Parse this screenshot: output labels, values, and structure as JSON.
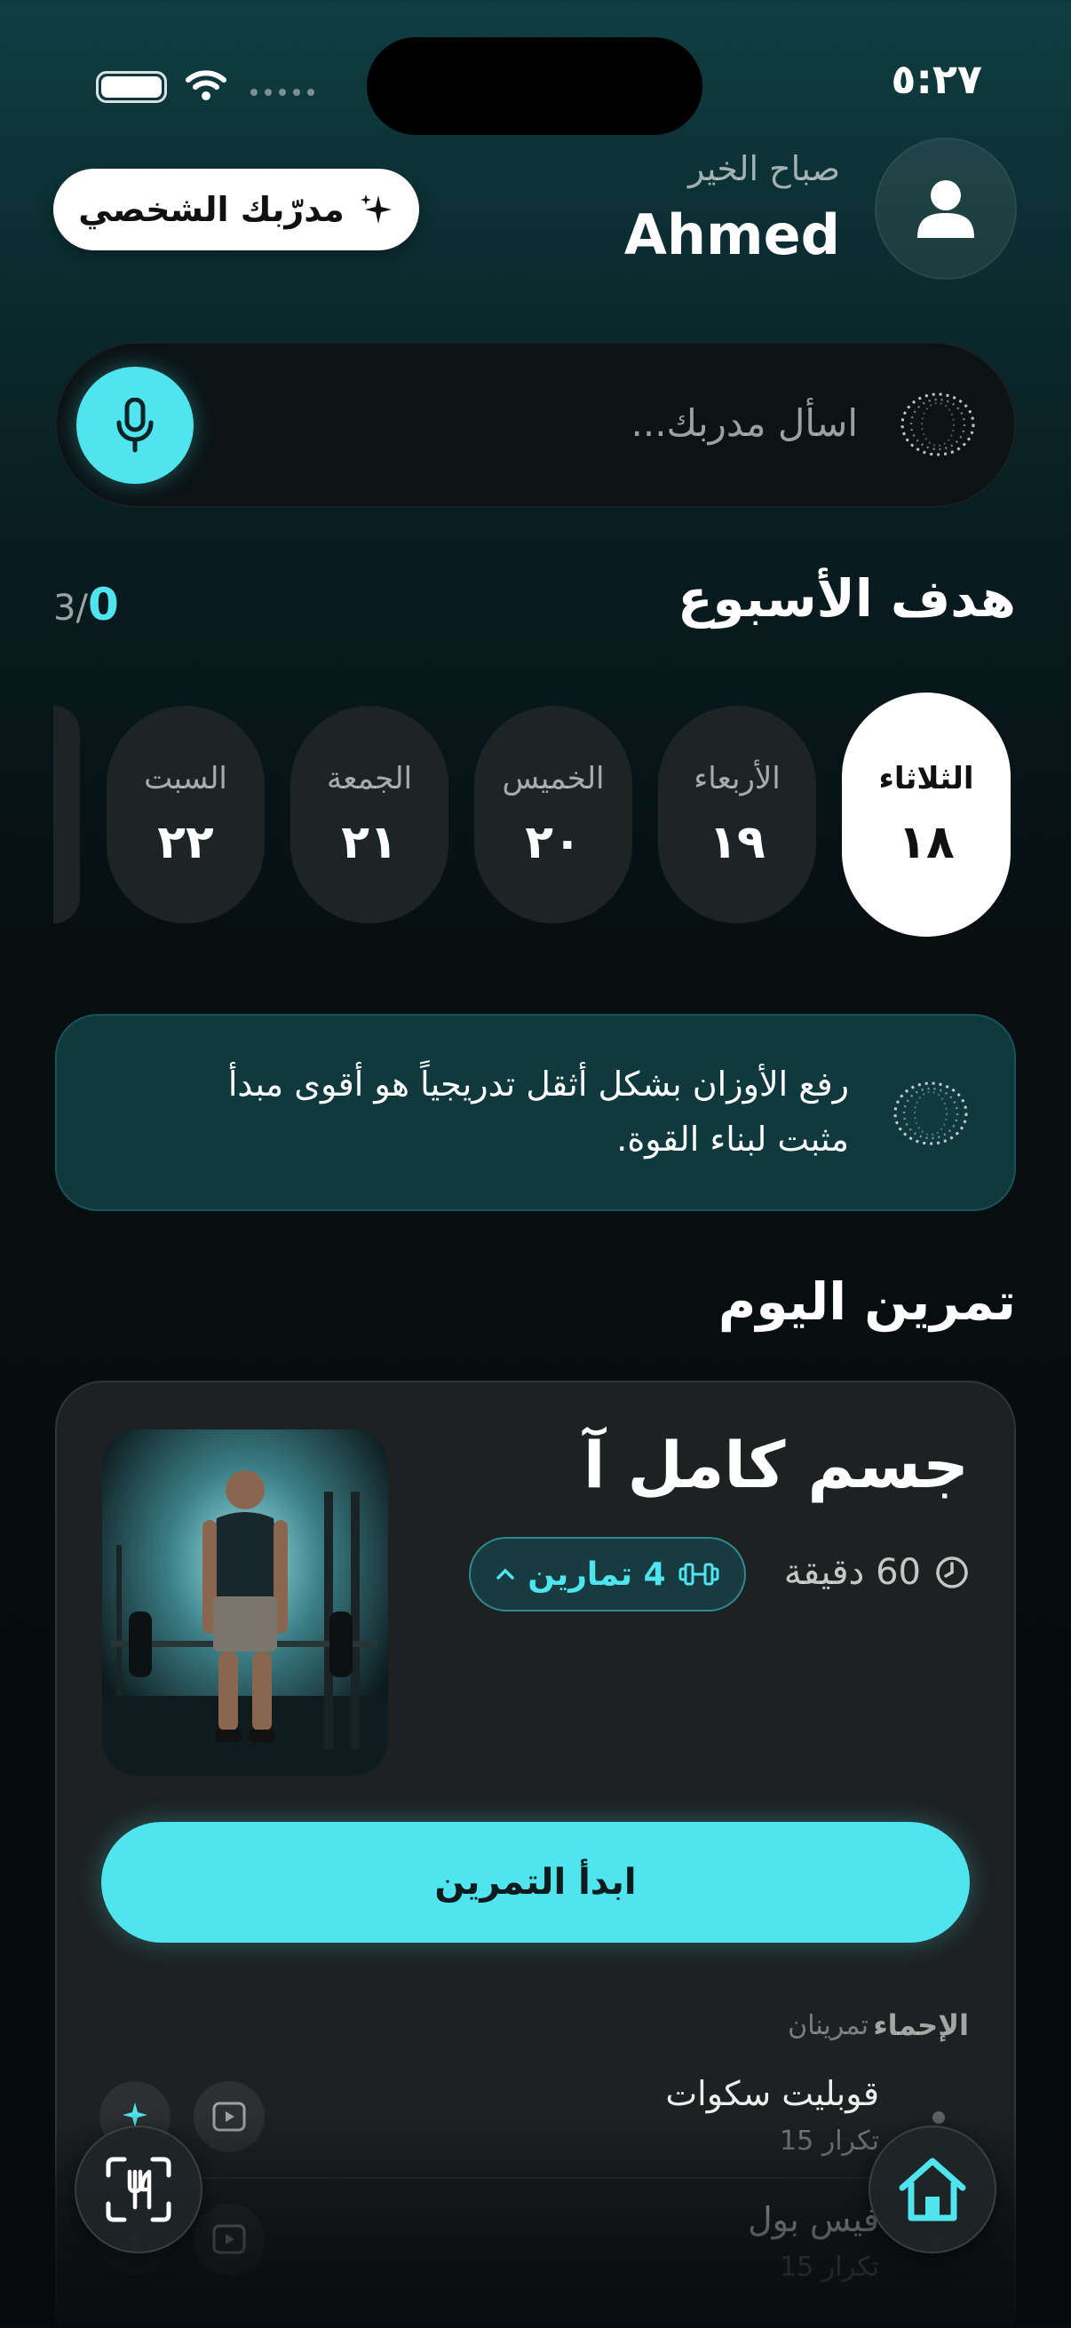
{
  "status": {
    "time": "٥:٢٧"
  },
  "header": {
    "greeting": "صباح الخير",
    "username": "Ahmed",
    "coach_button": "مدرّبك الشخصي",
    "avatar_icon": "user-icon"
  },
  "ask": {
    "placeholder": "اسأل مدربك...",
    "mic_icon": "microphone-icon"
  },
  "week": {
    "title": "هدف الأسبوع",
    "done": "0",
    "total": "3/",
    "days": [
      {
        "name": "الثلاثاء",
        "num": "١٨",
        "active": true
      },
      {
        "name": "الأربعاء",
        "num": "١٩",
        "active": false
      },
      {
        "name": "الخميس",
        "num": "٢٠",
        "active": false
      },
      {
        "name": "الجمعة",
        "num": "٢١",
        "active": false
      },
      {
        "name": "السبت",
        "num": "٢٢",
        "active": false
      }
    ]
  },
  "tip": {
    "text": "رفع الأوزان بشكل أثقل تدريجياً هو أقوى مبدأ مثبت لبناء القوة."
  },
  "today": {
    "title": "تمرين اليوم",
    "workout_name": "جسم كامل آ",
    "duration": "60 دقيقة",
    "exercises_pill": "4 تمارين",
    "start_button": "ابدأ التمرين",
    "warmup_label": "الإحماء",
    "warmup_count": "تمرينان",
    "exercises": [
      {
        "name": "قوبليت سكوات",
        "reps": "15 تكرار"
      },
      {
        "name": "فيس بول",
        "reps": "15 تكرار"
      }
    ]
  },
  "nav": {
    "home_icon": "home-icon",
    "food_scan_icon": "food-scan-icon"
  },
  "colors": {
    "accent": "#4fe4ee",
    "card": "#1d2122",
    "tip_bg": "#10393e"
  }
}
